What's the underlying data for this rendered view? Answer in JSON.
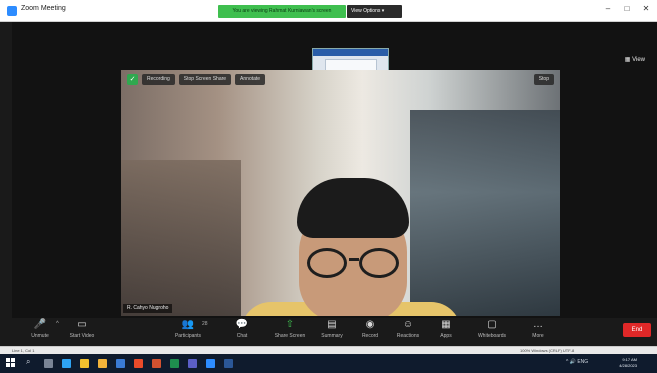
{
  "window": {
    "title": "Zoom Meeting",
    "minimize_glyph": "–",
    "maximize_glyph": "□",
    "close_glyph": "✕"
  },
  "share_banner": {
    "text": "You are viewing Rahmat Kurniawan's screen",
    "view_options": "View Options ▾"
  },
  "meeting": {
    "view_label": "▦ View",
    "top_pills": [
      "Recording",
      "Stop Screen Share",
      "Annotate"
    ],
    "right_pill": "Stop",
    "participant_name": "R. Cahyo Nugroho"
  },
  "toolbar": {
    "buttons": [
      {
        "label": "Unmute",
        "icon": "microphone-muted-icon",
        "glyph": "🎤"
      },
      {
        "label": "Start Video",
        "icon": "camera-icon",
        "glyph": "▭"
      },
      {
        "label": "Participants",
        "icon": "participants-icon",
        "glyph": "👥"
      },
      {
        "label": "Chat",
        "icon": "chat-icon",
        "glyph": "💬"
      },
      {
        "label": "Share Screen",
        "icon": "share-screen-icon",
        "glyph": "⇧"
      },
      {
        "label": "Summary",
        "icon": "summary-icon",
        "glyph": "▤"
      },
      {
        "label": "Record",
        "icon": "record-icon",
        "glyph": "◉"
      },
      {
        "label": "Reactions",
        "icon": "reactions-icon",
        "glyph": "☺"
      },
      {
        "label": "Apps",
        "icon": "apps-icon",
        "glyph": "▦"
      },
      {
        "label": "Whiteboards",
        "icon": "whiteboard-icon",
        "glyph": "▢"
      },
      {
        "label": "More",
        "icon": "more-icon",
        "glyph": "…"
      }
    ],
    "participant_count": "28",
    "end_label": "End"
  },
  "statusbar": {
    "left": "Line 1, Col 1",
    "middle": "100%  Windows (CRLF)  UTF-8"
  },
  "taskbar": {
    "search_glyph": "⌕",
    "tray_text": "^ 🔊 ENG",
    "time": "9:17 AM",
    "date": "4/28/2023",
    "apps": [
      {
        "name": "task-view-icon",
        "color": "#7a8596"
      },
      {
        "name": "edge-icon",
        "color": "#2ea3f2"
      },
      {
        "name": "chrome-icon",
        "color": "#f2c12e"
      },
      {
        "name": "explorer-icon",
        "color": "#f2b33a"
      },
      {
        "name": "store-icon",
        "color": "#3a7bd5"
      },
      {
        "name": "office-icon",
        "color": "#e94b2a"
      },
      {
        "name": "powerpoint-icon",
        "color": "#d35230"
      },
      {
        "name": "excel-icon",
        "color": "#1e8e4e"
      },
      {
        "name": "teams-icon",
        "color": "#5b5fc7"
      },
      {
        "name": "zoom-icon",
        "color": "#2d8cff"
      },
      {
        "name": "word-icon",
        "color": "#2b5797"
      }
    ]
  },
  "colors": {
    "accent_green": "#3fbf4f",
    "end_red": "#e02828",
    "zoom_blue": "#2d8cff"
  }
}
